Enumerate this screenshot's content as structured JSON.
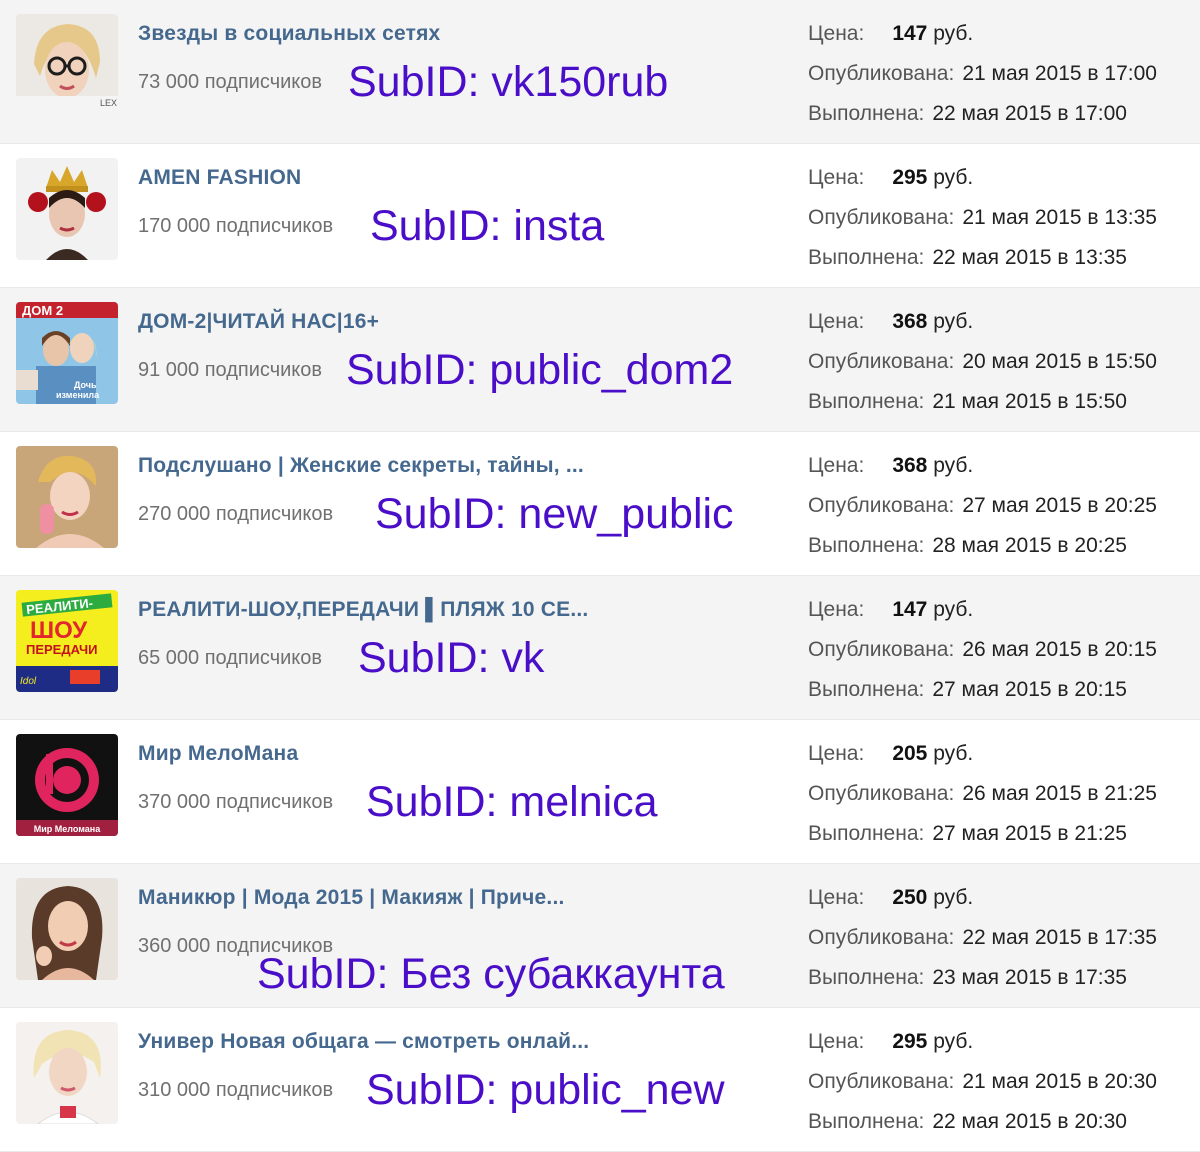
{
  "labels": {
    "price": "Цена:",
    "published": "Опубликована:",
    "completed": "Выполнена:",
    "currency": "руб."
  },
  "posts": [
    {
      "title": "Звезды в социальных сетях",
      "subscribers": "73 000 подписчиков",
      "subid": "SubID: vk150rub",
      "price": "147",
      "published": "21 мая 2015 в 17:00",
      "completed": "22 мая 2015 в 17:00",
      "avatar_icon": "woman-glasses-avatar-icon"
    },
    {
      "title": "AMEN FASHION",
      "subscribers": "170 000 подписчиков",
      "subid": "SubID: insta",
      "price": "295",
      "published": "21 мая 2015 в 13:35",
      "completed": "22 мая 2015 в 13:35",
      "avatar_icon": "woman-crown-avatar-icon"
    },
    {
      "title": "ДОМ-2|ЧИТАЙ НАС|16+",
      "subscribers": "91 000 подписчиков",
      "subid": "SubID: public_dom2",
      "price": "368",
      "published": "20 мая 2015 в 15:50",
      "completed": "21 мая 2015 в 15:50",
      "avatar_icon": "magazine-cover-avatar-icon"
    },
    {
      "title": "Подслушано | Женские секреты, тайны, ...",
      "subscribers": "270 000 подписчиков",
      "subid": "SubID: new_public",
      "price": "368",
      "published": "27 мая 2015 в 20:25",
      "completed": "28 мая 2015 в 20:25",
      "avatar_icon": "woman-phone-avatar-icon"
    },
    {
      "title": "РЕАЛИТИ-ШОУ,ПЕРЕДАЧИ ▌ПЛЯЖ 10 СЕ...",
      "subscribers": "65 000 подписчиков",
      "subid": "SubID: vk",
      "price": "147",
      "published": "26 мая 2015 в 20:15",
      "completed": "27 мая 2015 в 20:15",
      "avatar_icon": "reality-show-logo-avatar-icon"
    },
    {
      "title": "Мир МелоМана",
      "subscribers": "370 000 подписчиков",
      "subid": "SubID: melnica",
      "price": "205",
      "published": "26 мая 2015 в 21:25",
      "completed": "27 мая 2015 в 21:25",
      "avatar_icon": "beats-logo-avatar-icon",
      "avatar_caption": "Мир Меломана"
    },
    {
      "title": "Маникюр | Мода 2015 | Макияж | Приче...",
      "subscribers": "360 000 подписчиков",
      "subid": "SubID: Без субаккаунта",
      "price": "250",
      "published": "22 мая 2015 в 17:35",
      "completed": "23 мая 2015 в 17:35",
      "avatar_icon": "woman-portrait-avatar-icon"
    },
    {
      "title": "Универ Новая общага — смотреть онлай...",
      "subscribers": "310 000 подписчиков",
      "subid": "SubID: public_new",
      "price": "295",
      "published": "21 мая 2015 в 20:30",
      "completed": "22 мая 2015 в 20:30",
      "avatar_icon": "blonde-woman-avatar-icon"
    }
  ]
}
